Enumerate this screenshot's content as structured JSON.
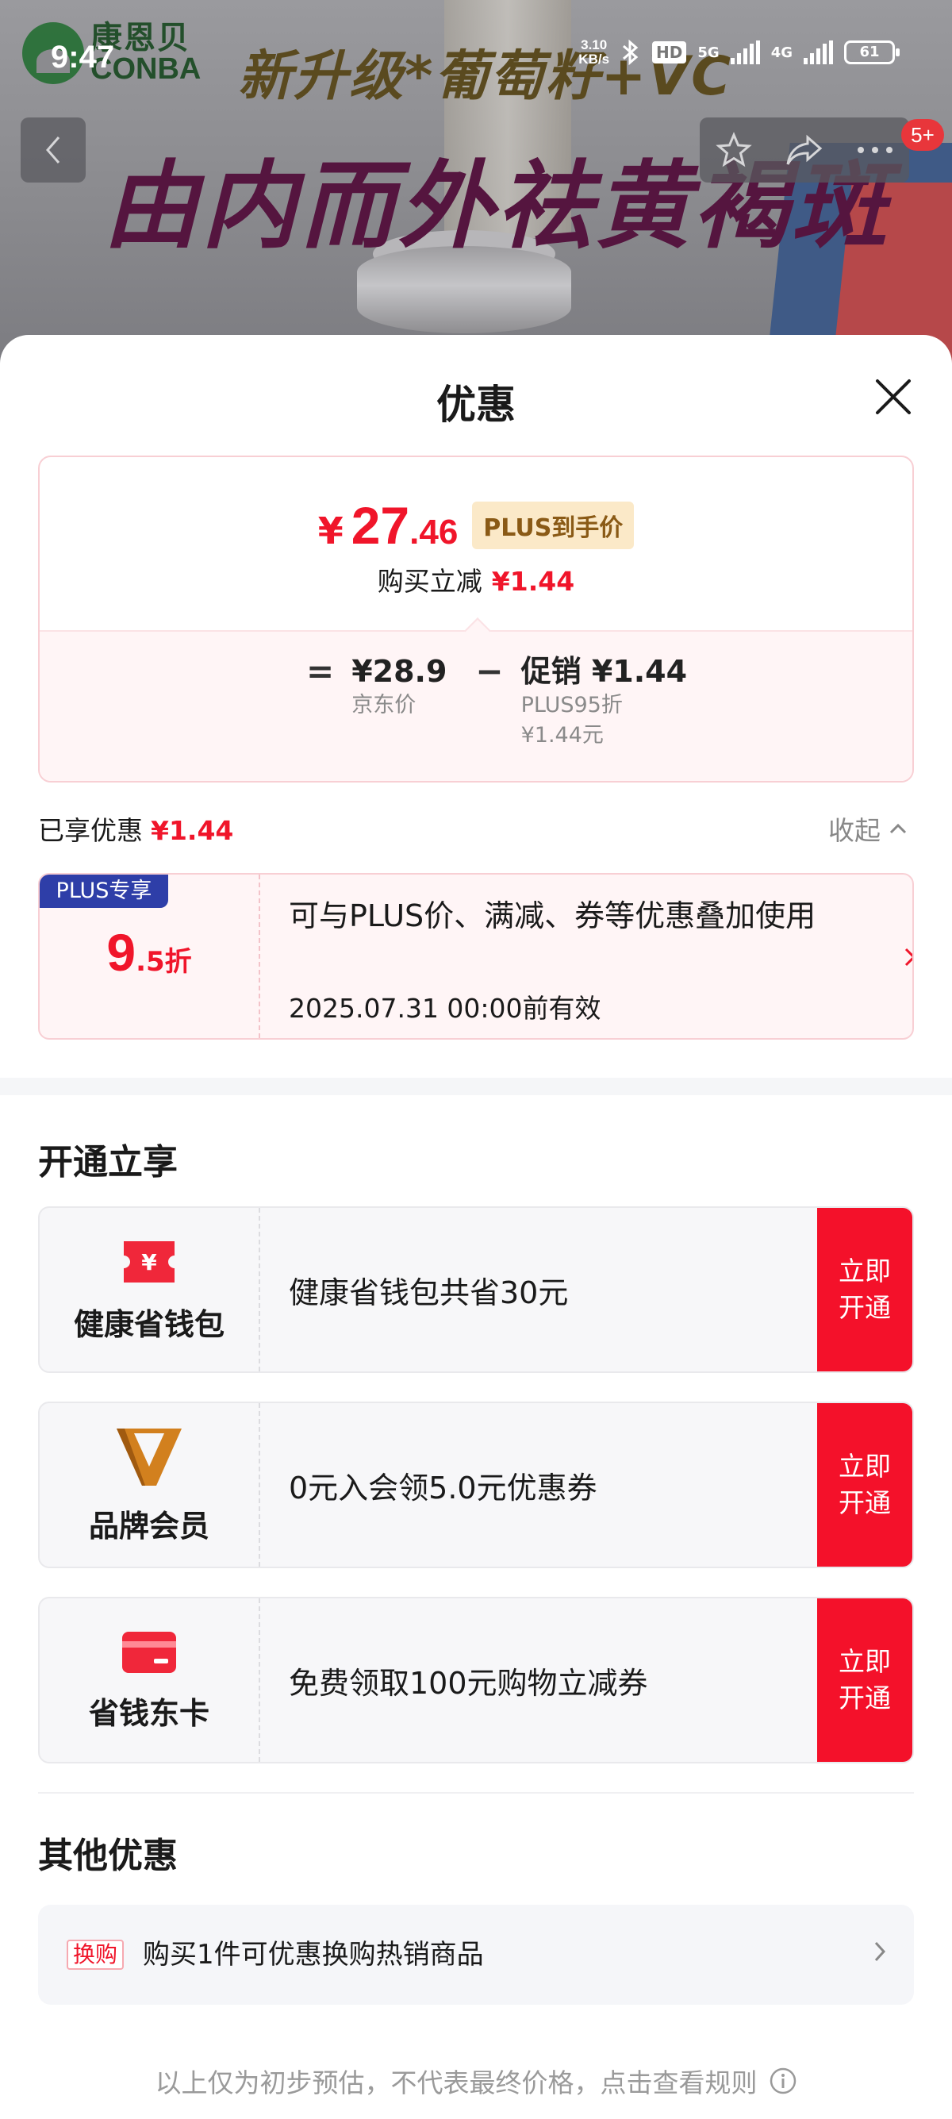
{
  "status_bar": {
    "time": "9:47",
    "speed_value": "3.10",
    "speed_unit": "KB/s",
    "hd": "HD",
    "net_5g": "5G",
    "net_4g": "4G",
    "battery": "61"
  },
  "banner": {
    "brand_cn": "康恩贝",
    "brand_en": "CONBA",
    "subtitle": "新升级*葡萄籽+VC",
    "headline": "由内而外祛黄褐斑",
    "badge": "5+"
  },
  "sheet": {
    "title": "优惠"
  },
  "price_summary": {
    "currency": "¥",
    "price_int": "27",
    "price_dec": ".46",
    "price_tag": "PLUS到手价",
    "reduce_label": "购买立减",
    "reduce_value": "¥1.44",
    "equals": "=",
    "jd_price": "¥28.9",
    "jd_label": "京东价",
    "minus": "−",
    "promo_value": "促销 ¥1.44",
    "promo_line1": "PLUS95折",
    "promo_line2": "¥1.44元"
  },
  "enjoyed": {
    "label": "已享优惠",
    "value": "¥1.44",
    "collapse_label": "收起"
  },
  "plus_coupon": {
    "tag": "PLUS专享",
    "discount_num": "9",
    "discount_unit": ".5折",
    "description": "可与PLUS价、满减、券等优惠叠加使用",
    "validity": "2025.07.31 00:00前有效"
  },
  "open_section": {
    "title": "开通立享",
    "items": [
      {
        "name": "健康省钱包",
        "desc": "健康省钱包共省30元",
        "button": "立即开通"
      },
      {
        "name": "品牌会员",
        "desc": "0元入会领5.0元优惠券",
        "button": "立即开通"
      },
      {
        "name": "省钱东卡",
        "desc": "免费领取100元购物立减券",
        "button": "立即开通"
      }
    ]
  },
  "other_section": {
    "title": "其他优惠",
    "tag": "换购",
    "text": "购买1件可优惠换购热销商品"
  },
  "footer": {
    "note": "以上仅为初步预估，不代表最终价格，点击查看规则"
  },
  "colors": {
    "accent_red": "#f0152a",
    "button_red": "#f4112a",
    "plus_blue": "#2e3ea8",
    "plus_gold_bg": "#fbe9c8"
  }
}
